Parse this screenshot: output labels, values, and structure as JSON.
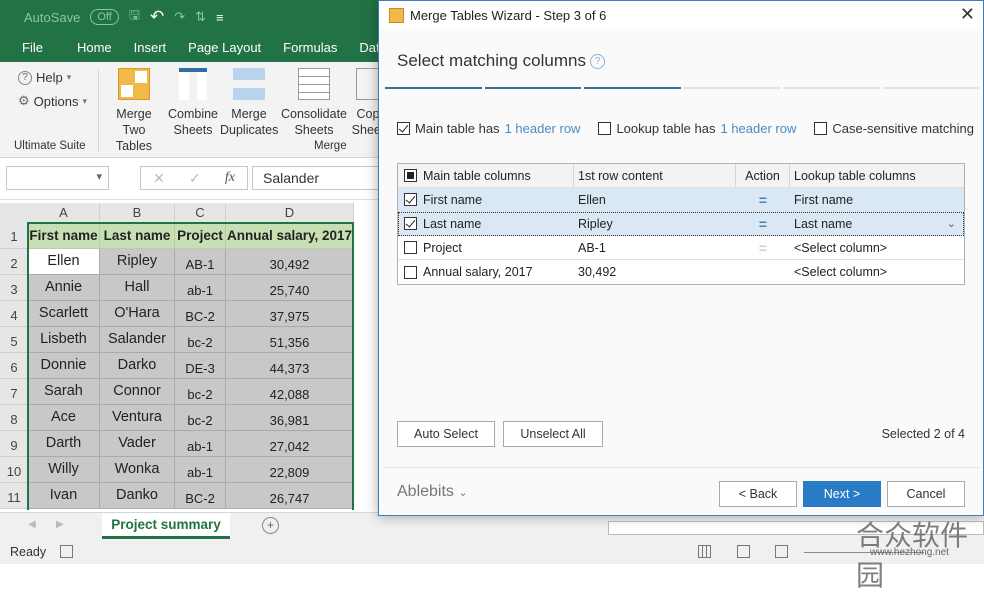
{
  "excel": {
    "qat": {
      "autosave_label": "AutoSave",
      "autosave_state": "Off"
    },
    "ribbon_tabs": [
      "File",
      "Home",
      "Insert",
      "Page Layout",
      "Formulas",
      "Data"
    ],
    "ribbon": {
      "help_label": "Help",
      "options_label": "Options",
      "group1_label": "Ultimate Suite",
      "group2_label": "Merge",
      "buttons": [
        {
          "line1": "Merge",
          "line2": "Two Tables"
        },
        {
          "line1": "Combine",
          "line2": "Sheets"
        },
        {
          "line1": "Merge",
          "line2": "Duplicates"
        },
        {
          "line1": "Consolidate",
          "line2": "Sheets"
        },
        {
          "line1": "Cop",
          "line2": "Sheet"
        }
      ]
    },
    "formula_bar": {
      "name_box": "",
      "fx_label": "fx",
      "cancel": "✕",
      "enter": "✓",
      "value": "Salander"
    },
    "columns": [
      "A",
      "B",
      "C",
      "D"
    ],
    "header_row": [
      "First name",
      "Last name",
      "Project",
      "Annual salary, 2017"
    ],
    "rows": [
      [
        "Ellen",
        "Ripley",
        "AB-1",
        "30,492"
      ],
      [
        "Annie",
        "Hall",
        "ab-1",
        "25,740"
      ],
      [
        "Scarlett",
        "O'Hara",
        "BC-2",
        "37,975"
      ],
      [
        "Lisbeth",
        "Salander",
        "bc-2",
        "51,356"
      ],
      [
        "Donnie",
        "Darko",
        "DE-3",
        "44,373"
      ],
      [
        "Sarah",
        "Connor",
        "bc-2",
        "42,088"
      ],
      [
        "Ace",
        "Ventura",
        "bc-2",
        "36,981"
      ],
      [
        "Darth",
        "Vader",
        "ab-1",
        "27,042"
      ],
      [
        "Willy",
        "Wonka",
        "ab-1",
        "22,809"
      ],
      [
        "Ivan",
        "Danko",
        "BC-2",
        "26,747"
      ]
    ],
    "row_numbers": [
      "1",
      "2",
      "3",
      "4",
      "5",
      "6",
      "7",
      "8",
      "9",
      "10",
      "11"
    ],
    "sheet_tab": "Project summary",
    "status": "Ready"
  },
  "dialog": {
    "title": "Merge Tables Wizard - Step 3 of 6",
    "subtitle": "Select matching columns",
    "help_glyph": "?",
    "steps_total": 6,
    "current_step": 3,
    "options": {
      "main_prefix": "Main table has",
      "main_link": "1 header row",
      "main_checked": true,
      "lookup_prefix": "Lookup table has",
      "lookup_link": "1 header row",
      "lookup_checked": false,
      "case_label": "Case-sensitive matching",
      "case_checked": false
    },
    "table": {
      "headers": [
        "Main table columns",
        "1st row content",
        "Action",
        "Lookup table columns"
      ],
      "rows": [
        {
          "main": "First name",
          "content": "Ellen",
          "action": "=",
          "lookup": "First name",
          "checked": true
        },
        {
          "main": "Last name",
          "content": "Ripley",
          "action": "=",
          "lookup": "Last name",
          "checked": true
        },
        {
          "main": "Project",
          "content": "AB-1",
          "action": "=",
          "lookup": "<Select column>",
          "checked": false
        },
        {
          "main": "Annual salary, 2017",
          "content": "30,492",
          "action": "",
          "lookup": "<Select column>",
          "checked": false
        }
      ]
    },
    "auto_select": "Auto Select",
    "unselect_all": "Unselect All",
    "selected_count": "Selected 2 of 4",
    "brand": "Ablebits",
    "back": "< Back",
    "next": "Next >",
    "cancel": "Cancel"
  },
  "watermark": {
    "text": "合众软件园",
    "url": "www.hezhong.net"
  }
}
